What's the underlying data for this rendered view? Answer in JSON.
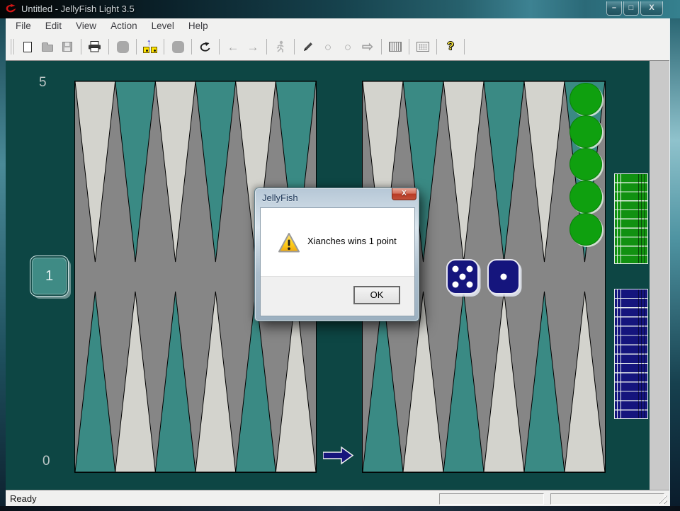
{
  "window": {
    "title": "Untitled - JellyFish Light 3.5",
    "app_icon": "jellyfish-fish-logo",
    "controls": {
      "minimize": "–",
      "maximize": "□",
      "close": "X"
    }
  },
  "menu": {
    "items": [
      "File",
      "Edit",
      "View",
      "Action",
      "Level",
      "Help"
    ]
  },
  "toolbar": {
    "icons": [
      "new-document",
      "open-file",
      "save-file",
      "print",
      "checker-gray-1",
      "roll-dice",
      "checker-gray-2",
      "undo",
      "back-arrow",
      "forward-arrow",
      "resign-runner",
      "edit-pencil",
      "circle-outline-1",
      "circle-outline-2",
      "play-arrow-outline",
      "board-hatched",
      "board-dotted",
      "help"
    ],
    "help_glyph": "?"
  },
  "board": {
    "score_top": "5",
    "score_bottom": "0",
    "cube": "1",
    "dice": [
      5,
      1
    ],
    "green_on_board": 5,
    "green_borne_off": 10,
    "blue_borne_off": 14,
    "points_top": [
      "light",
      "teal",
      "light",
      "teal",
      "light",
      "teal"
    ],
    "points_bottom": [
      "teal",
      "light",
      "teal",
      "light",
      "teal",
      "light"
    ]
  },
  "dialog": {
    "title": "JellyFish",
    "close_glyph": "X",
    "icon": "warning-triangle-icon",
    "message": "Xianches wins 1 point",
    "ok_label": "OK"
  },
  "statusbar": {
    "text": "Ready"
  },
  "colors": {
    "panel_teal": "#0d4644",
    "teal_point": "#3a8a84",
    "light_point": "#d3d3cd",
    "board_gray": "#868686",
    "checker_green": "#0fa00f",
    "borne_green": "#119111",
    "checker_navy": "#15157d",
    "die_navy": "#15157d"
  }
}
